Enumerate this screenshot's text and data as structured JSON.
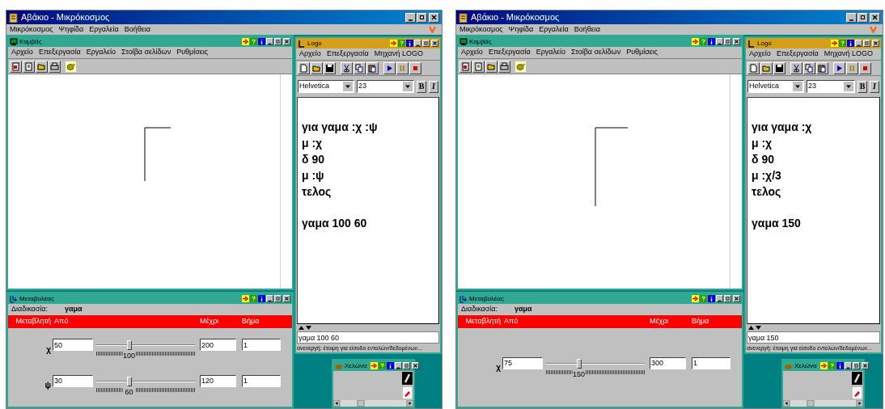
{
  "screens": [
    {
      "app": {
        "title": "Αβάκιο - Μικρόκοσμος",
        "menu": [
          "Μικρόκοσμος",
          "Ψηφίδα",
          "Εργαλεία",
          "Βοήθεια"
        ]
      },
      "canvas_window": {
        "title": "Καμβάς",
        "menu": [
          "Αρχείο",
          "Επεξεργασία",
          "Εργαλείο",
          "Στοίβα σελίδων",
          "Ρυθμίσεις"
        ]
      },
      "logo_window": {
        "title": "Logo",
        "menu": [
          "Αρχείο",
          "Επεξεργασία",
          "Μηχανή LOGO"
        ],
        "font": "Helvetica",
        "size": "23",
        "bold_label": "B",
        "italic_label": "I",
        "code_lines": [
          "για γαμα :χ :ψ",
          "μ :χ",
          "δ 90",
          "μ :ψ",
          "τελος"
        ],
        "run_line": "γαμα 100 60",
        "command": "γαμα 100 60",
        "status": "ανενεργή: έτοιμη για είσοδο εντολών/δεδομένων..."
      },
      "variables_window": {
        "title": "Μεταβολέας",
        "procedure_label": "Διαδικασία:",
        "procedure": "γαμα",
        "columns": [
          "Μεταβλητή",
          "Από",
          "Μέχρι",
          "Βήμα"
        ],
        "rows": [
          {
            "name": "χ",
            "from": "50",
            "value": "100",
            "to": "200",
            "step": "1",
            "level": 0.333
          },
          {
            "name": "ψ",
            "from": "30",
            "value": "60",
            "to": "120",
            "step": "1",
            "level": 0.333
          }
        ]
      },
      "turtle_window": {
        "title": "Χελώνα"
      }
    },
    {
      "app": {
        "title": "Αβάκιο - Μικρόκοσμος",
        "menu": [
          "Μικρόκοσμος",
          "Ψηφίδα",
          "Εργαλεία",
          "Βοήθεια"
        ]
      },
      "canvas_window": {
        "title": "Καμβάς",
        "menu": [
          "Αρχείο",
          "Επεξεργασία",
          "Εργαλείο",
          "Στοίβα σελίδων",
          "Ρυθμίσεις"
        ]
      },
      "logo_window": {
        "title": "Logo",
        "menu": [
          "Αρχείο",
          "Επεξεργασία",
          "Μηχανή LOGO"
        ],
        "font": "Helvetica",
        "size": "23",
        "bold_label": "B",
        "italic_label": "I",
        "code_lines": [
          "για γαμα :χ",
          "μ :χ",
          "δ 90",
          "μ :χ/3",
          "τελος"
        ],
        "run_line": "γαμα 150",
        "command": "γαμα 150",
        "status": "ανενεργή: έτοιμη για είσοδο εντολών/δεδομένων..."
      },
      "variables_window": {
        "title": "Μεταβολέας",
        "procedure_label": "Διαδικασία:",
        "procedure": "γαμα",
        "columns": [
          "Μεταβλητή",
          "Από",
          "Μέχρι",
          "Βήμα"
        ],
        "rows": [
          {
            "name": "χ",
            "from": "75",
            "value": "150",
            "to": "300",
            "step": "1",
            "level": 0.333
          }
        ]
      },
      "turtle_window": {
        "title": "Χελώνα"
      }
    }
  ]
}
